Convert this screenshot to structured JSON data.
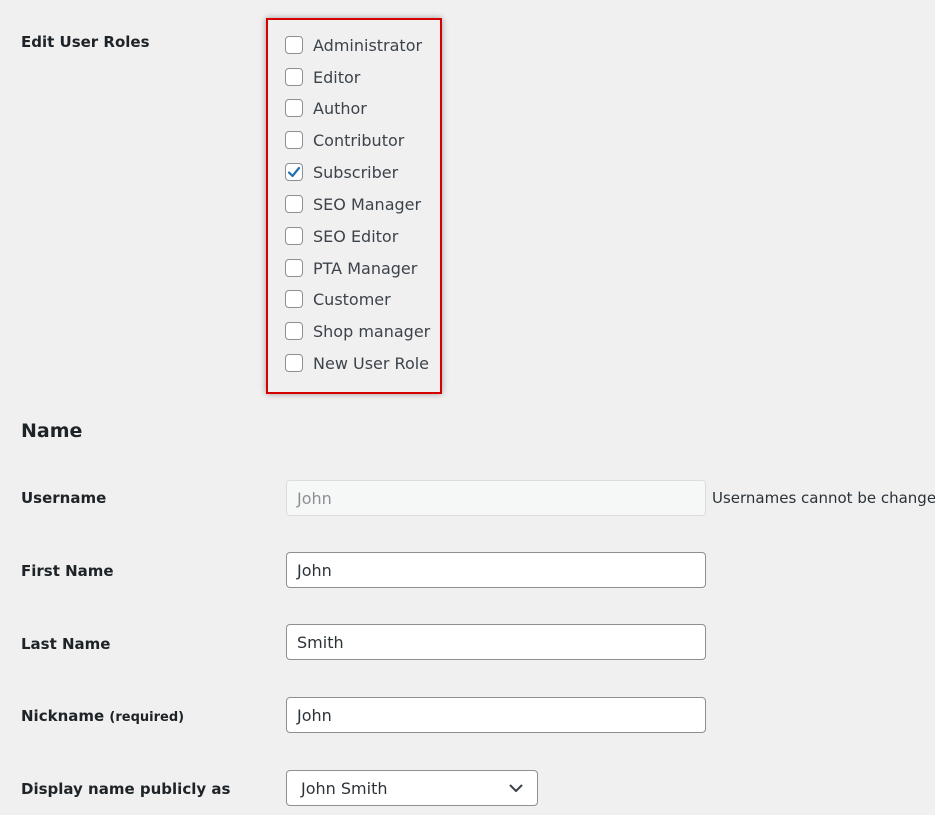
{
  "roles": {
    "label": "Edit User Roles",
    "items": [
      {
        "label": "Administrator",
        "checked": false
      },
      {
        "label": "Editor",
        "checked": false
      },
      {
        "label": "Author",
        "checked": false
      },
      {
        "label": "Contributor",
        "checked": false
      },
      {
        "label": "Subscriber",
        "checked": true
      },
      {
        "label": "SEO Manager",
        "checked": false
      },
      {
        "label": "SEO Editor",
        "checked": false
      },
      {
        "label": "PTA Manager",
        "checked": false
      },
      {
        "label": "Customer",
        "checked": false
      },
      {
        "label": "Shop manager",
        "checked": false
      },
      {
        "label": "New User Role",
        "checked": false
      }
    ]
  },
  "name_section": {
    "title": "Name",
    "username": {
      "label": "Username",
      "value": "John",
      "hint": "Usernames cannot be changed."
    },
    "first_name": {
      "label": "First Name",
      "value": "John"
    },
    "last_name": {
      "label": "Last Name",
      "value": "Smith"
    },
    "nickname": {
      "label": "Nickname",
      "required_note": "(required)",
      "value": "John"
    },
    "display_name": {
      "label": "Display name publicly as",
      "selected": "John Smith"
    }
  },
  "colors": {
    "highlight_border": "#d40000",
    "checkmark": "#2271b1",
    "background": "#f0f0f1"
  },
  "icons": {
    "checkmark": "checkmark-icon",
    "dropdown": "chevron-down-icon"
  }
}
